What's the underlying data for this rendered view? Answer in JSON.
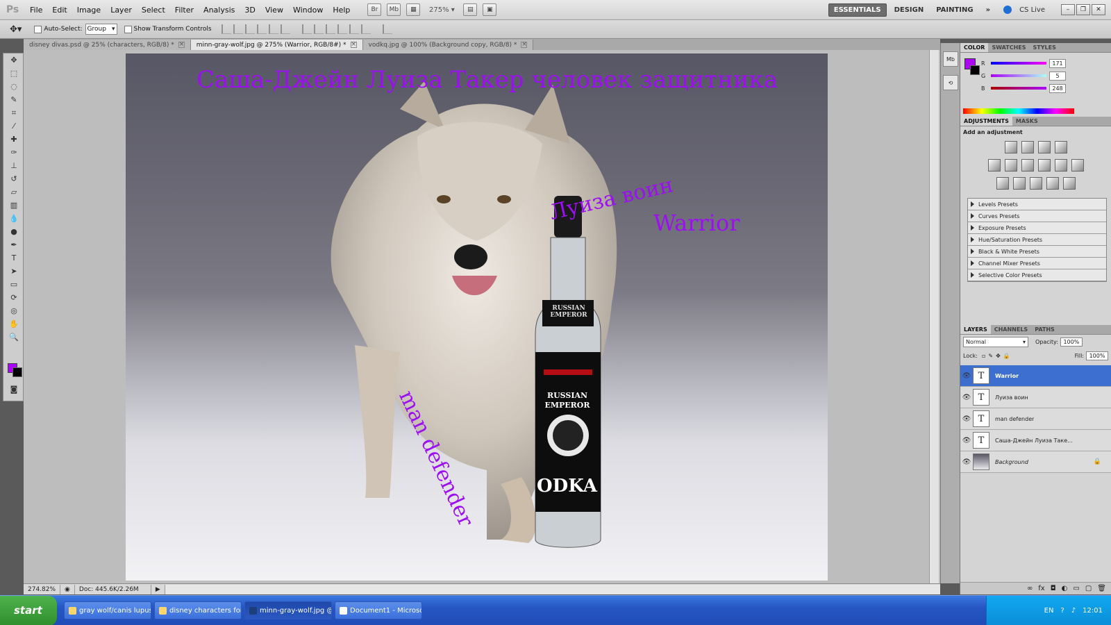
{
  "app": {
    "logo": "Ps",
    "menu": [
      "File",
      "Edit",
      "Image",
      "Layer",
      "Select",
      "Filter",
      "Analysis",
      "3D",
      "View",
      "Window",
      "Help"
    ],
    "zoom_dropdown": "275%",
    "workspaces": [
      "ESSENTIALS",
      "DESIGN",
      "PAINTING"
    ],
    "workspace_more": "»",
    "cs_live": "CS Live"
  },
  "options": {
    "auto_select_label": "Auto-Select:",
    "auto_select_value": "Group",
    "show_transform_label": "Show Transform Controls"
  },
  "tabs": [
    {
      "label": "disney divas.psd @ 25% (characters, RGB/8) *"
    },
    {
      "label": "minn-gray-wolf.jpg @ 275% (Warrior, RGB/8#) *"
    },
    {
      "label": "vodkq.jpg @ 100% (Background copy, RGB/8) *"
    }
  ],
  "canvas_text": {
    "title": "Саша-Джейн Луиза Такер человек защитника",
    "luiza": "Луиза воин",
    "warrior": "Warrior",
    "defender": "man defender",
    "bottle_brand_1": "RUSSIAN EMPEROR",
    "bottle_brand_2": "RUSSIAN EMPEROR",
    "bottle_word": "ODKA"
  },
  "status": {
    "zoom": "274.82%",
    "doc": "Doc: 445.6K/2.26M"
  },
  "color_panel": {
    "tabs": [
      "COLOR",
      "SWATCHES",
      "STYLES"
    ],
    "r_label": "R",
    "r_value": "171",
    "r_fraction": 0.67,
    "g_label": "G",
    "g_value": "5",
    "g_fraction": 0.02,
    "b_label": "B",
    "b_value": "248",
    "b_fraction": 0.97,
    "foreground": "#ab05f8"
  },
  "adjustments": {
    "tabs": [
      "ADJUSTMENTS",
      "MASKS"
    ],
    "heading": "Add an adjustment",
    "presets": [
      "Levels Presets",
      "Curves Presets",
      "Exposure Presets",
      "Hue/Saturation Presets",
      "Black & White Presets",
      "Channel Mixer Presets",
      "Selective Color Presets"
    ]
  },
  "layers_panel": {
    "tabs": [
      "LAYERS",
      "CHANNELS",
      "PATHS"
    ],
    "blend_mode": "Normal",
    "opacity_label": "Opacity:",
    "opacity": "100%",
    "lock_label": "Lock:",
    "fill_label": "Fill:",
    "fill": "100%",
    "layers": [
      {
        "name": "Warrior",
        "selected": true
      },
      {
        "name": "Луиза воин"
      },
      {
        "name": "man defender"
      },
      {
        "name": "Саша-Джейн Луиза Таке..."
      },
      {
        "name": "Background"
      }
    ]
  },
  "taskbar": {
    "start": "start",
    "buttons": [
      {
        "label": "gray wolf/canis lupus ..."
      },
      {
        "label": "disney characters for..."
      },
      {
        "label": "minn-gray-wolf.jpg @..."
      },
      {
        "label": "Document1 - Microsof..."
      }
    ],
    "lang": "EN",
    "clock": "12:01"
  }
}
